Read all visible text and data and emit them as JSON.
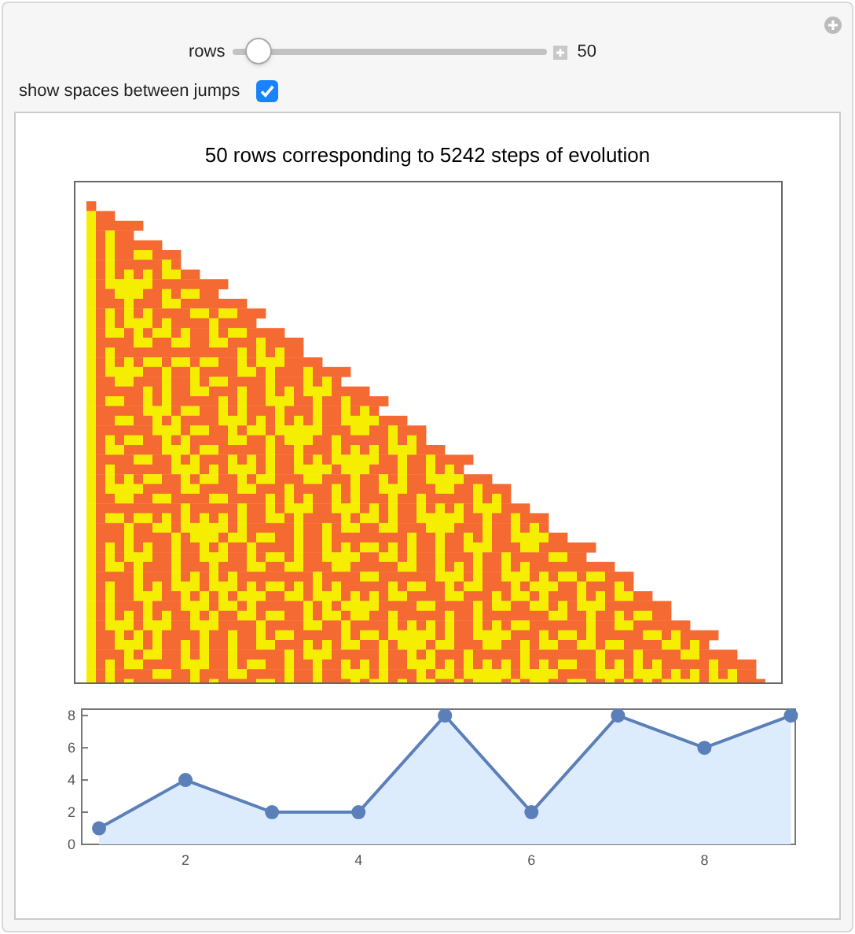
{
  "controls": {
    "rows": {
      "label": "rows",
      "level": 0.08,
      "value": "50"
    },
    "spaces": {
      "label": "show spaces between jumps",
      "checked": true
    }
  },
  "plot": {
    "title": "50 rows corresponding to 5242 steps of evolution"
  },
  "chart": {
    "chart_data": {
      "type": "area",
      "x": [
        1,
        2,
        3,
        4,
        5,
        6,
        7,
        8,
        9
      ],
      "series": [
        {
          "color": "#5b7fb8",
          "values": [
            1,
            4,
            2,
            2,
            8,
            2,
            8,
            6,
            8
          ]
        }
      ],
      "xlim": [
        0.8,
        9.05
      ],
      "ylim": [
        0,
        8.4
      ],
      "xticks": [
        2,
        4,
        6,
        8
      ],
      "yticks": [
        0,
        2,
        4,
        6,
        8
      ]
    }
  }
}
